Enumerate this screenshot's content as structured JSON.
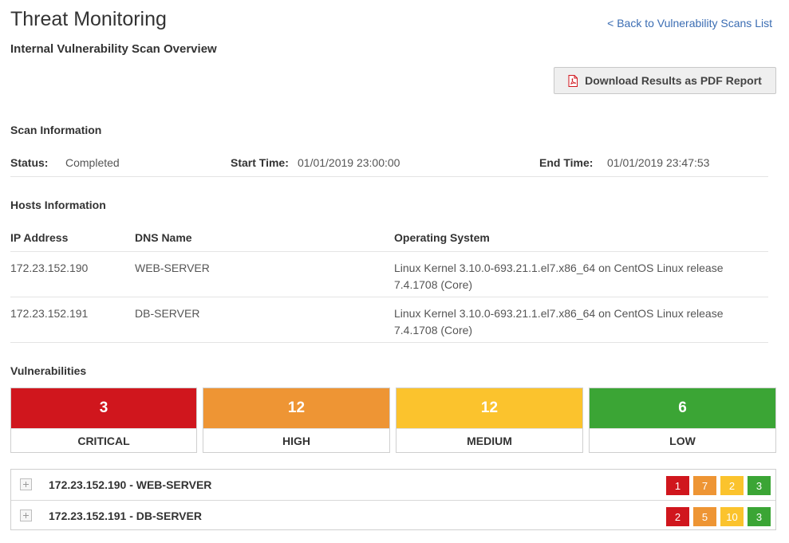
{
  "header": {
    "title": "Threat Monitoring",
    "subtitle": "Internal Vulnerability Scan Overview",
    "back_link": "< Back to Vulnerability Scans List",
    "pdf_button": "Download Results as PDF Report"
  },
  "scan_info": {
    "title": "Scan Information",
    "status_label": "Status:",
    "status_value": "Completed",
    "start_label": "Start Time:",
    "start_value": "01/01/2019 23:00:00",
    "end_label": "End Time:",
    "end_value": "01/01/2019 23:47:53"
  },
  "hosts": {
    "title": "Hosts Information",
    "columns": [
      "IP Address",
      "DNS Name",
      "Operating System"
    ],
    "rows": [
      {
        "ip": "172.23.152.190",
        "dns": "WEB-SERVER",
        "os": "Linux Kernel 3.10.0-693.21.1.el7.x86_64 on CentOS Linux release 7.4.1708 (Core)"
      },
      {
        "ip": "172.23.152.191",
        "dns": "DB-SERVER",
        "os": "Linux Kernel 3.10.0-693.21.1.el7.x86_64 on CentOS Linux release 7.4.1708 (Core)"
      }
    ]
  },
  "vulnerabilities": {
    "title": "Vulnerabilities",
    "summary": [
      {
        "label": "CRITICAL",
        "count": "3",
        "color": "#d0161d"
      },
      {
        "label": "HIGH",
        "count": "12",
        "color": "#ee9534"
      },
      {
        "label": "MEDIUM",
        "count": "12",
        "color": "#fbc32d"
      },
      {
        "label": "LOW",
        "count": "6",
        "color": "#3ba535"
      }
    ],
    "hosts": [
      {
        "title": "172.23.152.190 - WEB-SERVER",
        "counts": [
          "1",
          "7",
          "2",
          "3"
        ]
      },
      {
        "title": "172.23.152.191 - DB-SERVER",
        "counts": [
          "2",
          "5",
          "10",
          "3"
        ]
      }
    ]
  }
}
